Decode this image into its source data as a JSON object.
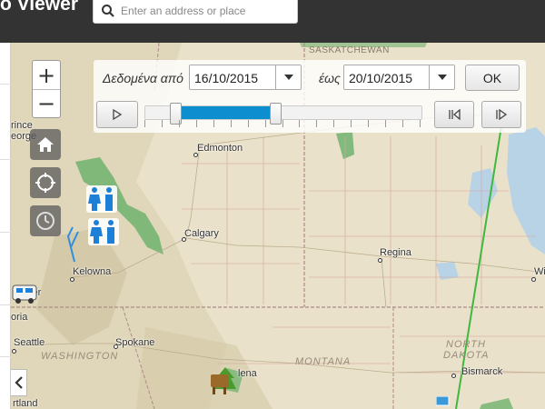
{
  "header": {
    "app_title": "o Viewer",
    "search_placeholder": "Enter an address or place"
  },
  "zoom": {
    "in_label": "+",
    "out_label": "−"
  },
  "map_tools": [
    "home-icon",
    "locate-icon",
    "clock-icon"
  ],
  "time_filter": {
    "from_label": "Δεδομένα από",
    "from_date": "16/10/2015",
    "to_label": "έως",
    "to_date": "20/10/2015",
    "ok_label": "OK",
    "slider_start_fraction": 0.11,
    "slider_end_fraction": 0.47
  },
  "map": {
    "cities": [
      "Edmonton",
      "Calgary",
      "Regina",
      "Kelowna",
      "Spokane",
      "Seattle",
      "Bismarck",
      "Wi",
      "ver",
      "oria",
      "rtland",
      "lena",
      "rince",
      "eorge"
    ],
    "regions": [
      "SASKATCHEWAN",
      "WASHINGTON",
      "MONTANA",
      "NORTH",
      "DAKOTA"
    ],
    "colors": {
      "land": "#e9e1c9",
      "forest": "#6fb36f",
      "route": "#3eb83e",
      "track": "#2f8fe0",
      "slider": "#0d8ecf"
    }
  }
}
